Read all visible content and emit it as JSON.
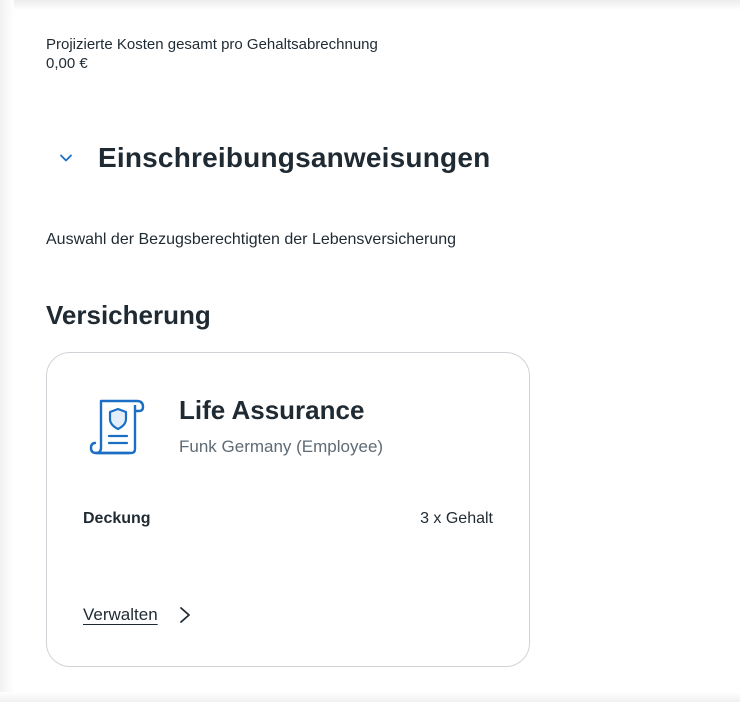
{
  "summary": {
    "projected_cost_label": "Projizierte Kosten gesamt pro Gehaltsabrechnung",
    "projected_cost_value": "0,00 €"
  },
  "enrollment": {
    "title": "Einschreibungsanweisungen",
    "expanded": true,
    "chevron_icon": "chevron-down-icon",
    "instructions": "Auswahl der Bezugsberechtigten der Lebensversicherung"
  },
  "insurance": {
    "heading": "Versicherung",
    "card": {
      "icon": "policy-document-icon",
      "title": "Life Assurance",
      "provider": "Funk Germany (Employee)",
      "coverage_label": "Deckung",
      "coverage_value": "3 x Gehalt",
      "manage_label": "Verwalten",
      "manage_icon": "chevron-right-icon"
    }
  },
  "colors": {
    "accent": "#1a6fc4",
    "text": "#1f2a33",
    "muted_text": "#5e6b75",
    "card_border": "#cfd3d7"
  }
}
